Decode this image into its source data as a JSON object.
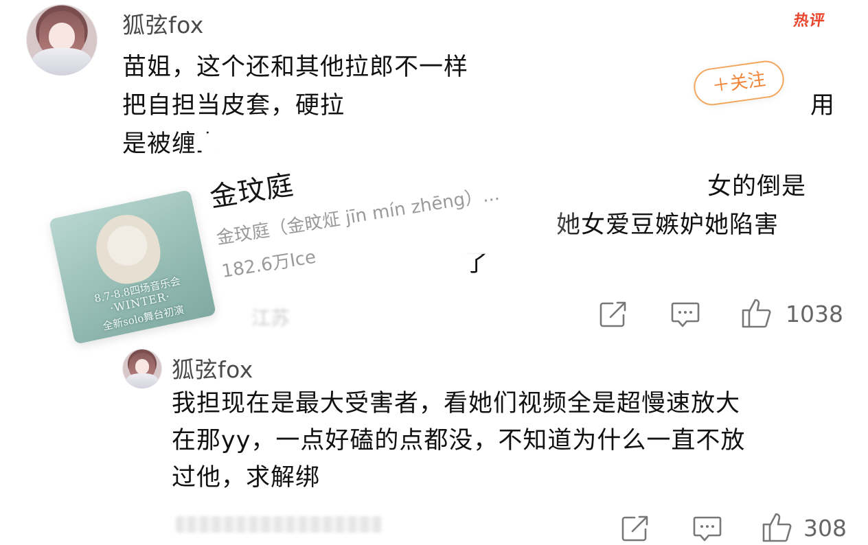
{
  "hot_badge": "热评",
  "comment": {
    "username": "狐弦fox",
    "lines": [
      "苗姐，这个还和其他拉郎不一样",
      "把自担当皮套，硬拉",
      "是被缠上"
    ],
    "line_end_fragment": "用",
    "visible_fragments": [
      "女的倒是",
      "她女爱豆嫉妒她陷害",
      "了"
    ],
    "location_fragment": "江苏",
    "like_count": "1038"
  },
  "follow_button": {
    "label": "＋关注"
  },
  "popup": {
    "title": "金玟庭",
    "subtitle": "金玟庭（金旼炡 jīn mín zhēng）...",
    "fans": "182.6万Ice",
    "poster": {
      "line1": "8.7-8.8四场音乐会",
      "line2": "·WINTER·",
      "line3": "全新solo舞台初演"
    }
  },
  "reply": {
    "username": "狐弦fox",
    "lines": [
      "我担现在是最大受害者，看她们视频全是超慢速放大",
      "在那yy，一点好磕的点都没，不知道为什么一直不放",
      "过他，求解绑"
    ],
    "like_count": "308"
  },
  "icons": [
    "share-icon",
    "comment-icon",
    "like-icon"
  ],
  "colors": {
    "hot": "#e8452c",
    "follow": "#f0853a",
    "text": "#111111",
    "meta": "#666666"
  }
}
